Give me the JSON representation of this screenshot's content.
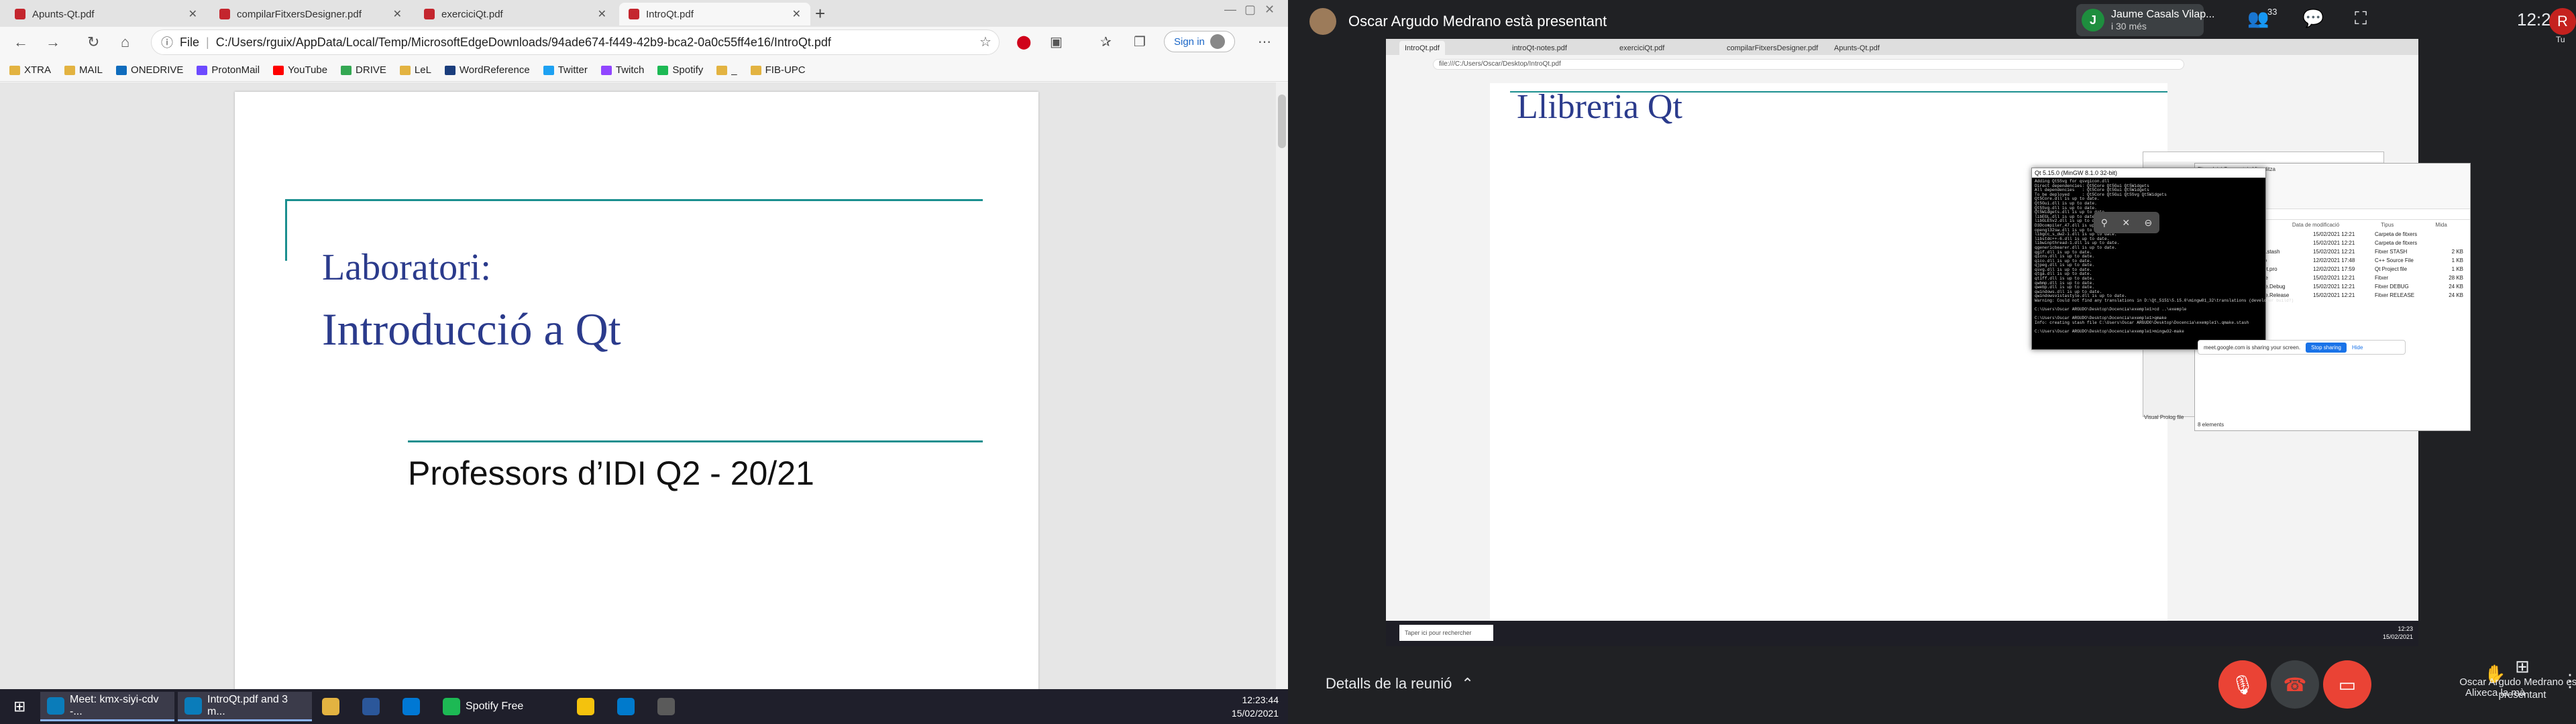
{
  "edge": {
    "tabs": [
      {
        "label": "Apunts-Qt.pdf"
      },
      {
        "label": "compilarFitxersDesigner.pdf"
      },
      {
        "label": "exerciciQt.pdf"
      },
      {
        "label": "IntroQt.pdf"
      }
    ],
    "new_tab": "+",
    "window_controls": {
      "minimize": "—",
      "maximize": "▢",
      "close": "✕"
    },
    "url_label": "File",
    "url": "C:/Users/rguix/AppData/Local/Temp/MicrosoftEdgeDownloads/94ade674-f449-42b9-bca2-0a0c55ff4e16/IntroQt.pdf",
    "sign_in": "Sign in",
    "favorites": [
      {
        "label": "XTRA",
        "color": "#e3b341"
      },
      {
        "label": "MAIL",
        "color": "#e3b341"
      },
      {
        "label": "ONEDRIVE",
        "color": "#0f6cbd"
      },
      {
        "label": "ProtonMail",
        "color": "#6d4aff"
      },
      {
        "label": "YouTube",
        "color": "#ff0000"
      },
      {
        "label": "DRIVE",
        "color": "#34a853"
      },
      {
        "label": "LeL",
        "color": "#e3b341"
      },
      {
        "label": "WordReference",
        "color": "#1a3d7c"
      },
      {
        "label": "Twitter",
        "color": "#1da1f2"
      },
      {
        "label": "Twitch",
        "color": "#9146ff"
      },
      {
        "label": "Spotify",
        "color": "#1db954"
      },
      {
        "label": "_",
        "color": "#e3b341"
      },
      {
        "label": "FIB-UPC",
        "color": "#e3b341"
      }
    ],
    "pdf": {
      "line1": "Laboratori:",
      "line2": "Introducció a Qt",
      "professors": "Professors d’IDI Q2 - 20/21"
    }
  },
  "taskbar": {
    "items": [
      {
        "label": "Meet: kmx-siyi-cdv -...",
        "color": "#0a7cba"
      },
      {
        "label": "IntroQt.pdf and 3 m...",
        "color": "#0a7cba"
      },
      {
        "label": "",
        "color": "#e3b341"
      },
      {
        "label": "",
        "color": "#2b579a"
      },
      {
        "label": "",
        "color": "#0078d4"
      },
      {
        "label": "Spotify Free",
        "color": "#1db954"
      },
      {
        "label": "",
        "color": "#f4c20d"
      },
      {
        "label": "",
        "color": "#007acc"
      },
      {
        "label": "",
        "color": "#5a5a5a"
      }
    ],
    "time": "12:23:44",
    "date": "15/02/2021"
  },
  "meet": {
    "presenter": "Oscar Argudo Medrano està presentant",
    "joined_initial": "J",
    "joined_name": "Jaume Casals Vilap...",
    "joined_more": "i 30 més",
    "participants_count": "33",
    "clock": "12:23",
    "my_initial": "R",
    "you_label": "Tu",
    "details": "Detalls de la reunió",
    "raise_hand": "Alixeca la mà",
    "presenting": "Oscar Argudo Medrano està presentant"
  },
  "shared": {
    "tabs": [
      "IntroQt.pdf",
      "introQt-notes.pdf",
      "exerciciQt.pdf",
      "compilarFitxersDesigner.pdf",
      "Apunts-Qt.pdf"
    ],
    "url": "file:///C:/Users/Oscar/Desktop/IntroQt.pdf",
    "title": "Llibreria Qt",
    "cmd_title": "Qt 5.15.0 (MinGW 8.1.0 32-bit)",
    "cmd_lines": [
      "Adding Qt5Svg for qsvgicon.dll",
      "Direct dependencies: Qt5Core Qt5Gui Qt5Widgets",
      "All dependencies   : Qt5Core Qt5Gui Qt5Widgets",
      "To be deployed     : Qt5Core Qt5Gui Qt5Svg Qt5Widgets",
      "Qt5Core.dll is up to date.",
      "Qt5Gui.dll is up to date.",
      "Qt5Svg.dll is up to date.",
      "Qt5Widgets.dll is up to date.",
      "libEGL.dll is up to date.",
      "libGLESv2.dll is up to date.",
      "D3Dcompiler_47.dll is up to date.",
      "opengl32sw.dll is up to date.",
      "libgcc_s_dw2-1.dll is up to date.",
      "libstdc++-6.dll is up to date.",
      "libwinpthread-1.dll is up to date.",
      "qgenericbearer.dll is up to date.",
      "qgif.dll is up to date.",
      "qicns.dll is up to date.",
      "qico.dll is up to date.",
      "qjpeg.dll is up to date.",
      "qsvg.dll is up to date.",
      "qtga.dll is up to date.",
      "qtiff.dll is up to date.",
      "qwbmp.dll is up to date.",
      "qwebp.dll is up to date.",
      "qwindows.dll is up to date.",
      "qwindowsvistastyle.dll is up to date.",
      "Warning: Could not find any translations in D:\\Qt_5151\\5.15.0\\mingw81_32\\translations (developer build?)",
      "",
      "C:\\Users\\Oscar ARGUDO\\Desktop\\Docencia\\exemple1>cd ..\\exemple",
      "",
      "C:\\Users\\Oscar ARGUDO\\Desktop\\Docencia\\exemple1>qmake",
      "Info: creating stash file C:\\Users\\Oscar ARGUDO\\Desktop\\Docencia\\exemple1\\.qmake.stash",
      "",
      "C:\\Users\\Oscar ARGUDO\\Desktop\\Docencia\\exemple1>mingw32-make"
    ],
    "explorer": {
      "ribbon": "Fitxer   Inici   Comparteix   Visualitza",
      "path": "exemple1",
      "headers": [
        "Nom",
        "Data de modificació",
        "Tipus",
        "Mida"
      ],
      "rows": [
        {
          "name": "debug",
          "date": "15/02/2021 12:21",
          "kind": "Carpeta de fitxers",
          "size": "",
          "folder": true
        },
        {
          "name": "release",
          "date": "15/02/2021 12:21",
          "kind": "Carpeta de fitxers",
          "size": "",
          "folder": true
        },
        {
          "name": ".qmake.stash",
          "date": "15/02/2021 12:21",
          "kind": "Fitxer STASH",
          "size": "2 KB",
          "folder": false
        },
        {
          "name": "ex1.cpp",
          "date": "12/02/2021 17:48",
          "kind": "C++ Source File",
          "size": "1 KB",
          "folder": false
        },
        {
          "name": "hello1Qt.pro",
          "date": "12/02/2021 17:59",
          "kind": "Qt Project file",
          "size": "1 KB",
          "folder": false
        },
        {
          "name": "Makefile",
          "date": "15/02/2021 12:21",
          "kind": "Fitxer",
          "size": "28 KB",
          "folder": false
        },
        {
          "name": "Makefile.Debug",
          "date": "15/02/2021 12:21",
          "kind": "Fitxer DEBUG",
          "size": "24 KB",
          "folder": false
        },
        {
          "name": "Makefile.Release",
          "date": "15/02/2021 12:21",
          "kind": "Fitxer RELEASE",
          "size": "24 KB",
          "folder": false
        }
      ],
      "footer": "8 elements"
    },
    "back_footer": "Visual Prolog file",
    "share_notice": "meet.google.com is sharing your screen.",
    "stop_sharing": "Stop sharing",
    "hide": "Hide",
    "search": "Taper ici pour rechercher",
    "remote_time": "12:23",
    "remote_date": "15/02/2021"
  }
}
